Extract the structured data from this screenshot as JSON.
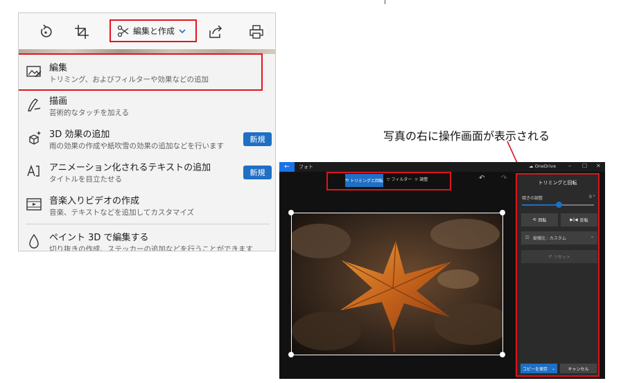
{
  "menu": {
    "toolbar": {
      "edit_create_label": "編集と作成"
    },
    "items": [
      {
        "title": "編集",
        "desc": "トリミング、およびフィルターや効果などの追加",
        "badge": ""
      },
      {
        "title": "描画",
        "desc": "芸術的なタッチを加える",
        "badge": ""
      },
      {
        "title": "3D 効果の追加",
        "desc": "雨の効果の作成や紙吹雪の効果の追加などを行います",
        "badge": "新規"
      },
      {
        "title": "アニメーション化されるテキストの追加",
        "desc": "タイトルを目立たせる",
        "badge": "新規"
      },
      {
        "title": "音楽入りビデオの作成",
        "desc": "音楽、テキストなどを追加してカスタマイズ",
        "badge": ""
      },
      {
        "title": "ペイント 3D で編集する",
        "desc": "切り抜きの作成、ステッカーの追加などを行うことができます",
        "badge": ""
      }
    ]
  },
  "annotation": "写真の右に操作画面が表示される",
  "editor": {
    "app_name": "フォト",
    "onedrive": "OneDrive",
    "window_controls": [
      "–",
      "☐",
      "✕"
    ],
    "tabs": {
      "crop_rotate": "トリミングと回転",
      "filter": "フィルター",
      "adjust": "調整"
    },
    "panel": {
      "title": "トリミングと回転",
      "tilt_label": "傾きの調整",
      "tilt_value": "0 °",
      "rotate_label": "回転",
      "flip_label": "反転",
      "aspect_label": "縦横比 : カスタム",
      "reset_label": "リセット",
      "save_label": "コピーを保存",
      "cancel_label": "キャンセル"
    }
  },
  "colors": {
    "highlight_red": "#e0141e",
    "accent_blue": "#1f6fc4",
    "dark_bg": "#111111",
    "panel_bg": "#2b2b2b"
  }
}
